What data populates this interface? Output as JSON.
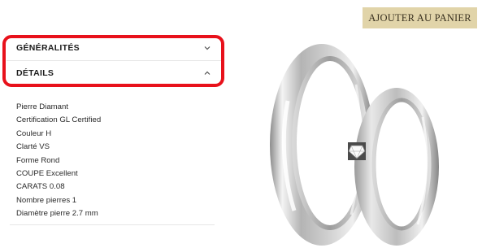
{
  "actions": {
    "add_to_cart": "AJOUTER AU PANIER"
  },
  "accordion": {
    "sections": [
      {
        "label": "GÉNÉRALITÉS",
        "state": "collapsed",
        "chevron": "chevron-down-icon"
      },
      {
        "label": "DÉTAILS",
        "state": "expanded",
        "chevron": "chevron-up-icon"
      }
    ],
    "details": [
      "Pierre Diamant",
      "Certification GL Certified",
      "Couleur H",
      "Clarté VS",
      "Forme Rond",
      "COUPE Excellent",
      "CARATS 0.08",
      "Nombre pierres 1",
      "Diamètre pierre 2.7 mm"
    ]
  },
  "annotation": {
    "color": "#e8111b"
  },
  "product_image": {
    "icon": "wedding-rings-image"
  },
  "colors": {
    "button_bg": "#e1d4a9",
    "button_text": "#3a3220"
  }
}
